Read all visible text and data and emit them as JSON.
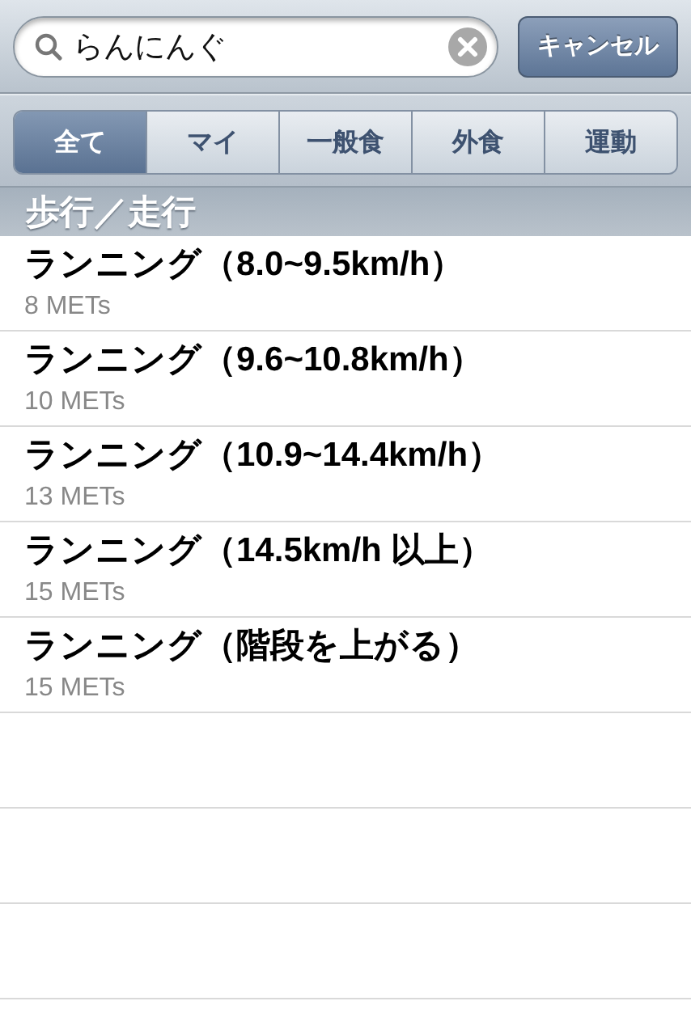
{
  "search": {
    "value": "らんにんぐ",
    "cancel": "キャンセル"
  },
  "tabs": [
    {
      "label": "全て",
      "selected": true
    },
    {
      "label": "マイ",
      "selected": false
    },
    {
      "label": "一般食",
      "selected": false
    },
    {
      "label": "外食",
      "selected": false
    },
    {
      "label": "運動",
      "selected": false
    }
  ],
  "section": {
    "title": "歩行／走行"
  },
  "rows": [
    {
      "title": "ランニング（8.0~9.5km/h）",
      "subtitle": "8 METs"
    },
    {
      "title": "ランニング（9.6~10.8km/h）",
      "subtitle": "10 METs"
    },
    {
      "title": "ランニング（10.9~14.4km/h）",
      "subtitle": "13 METs"
    },
    {
      "title": "ランニング（14.5km/h 以上）",
      "subtitle": "15 METs"
    },
    {
      "title": "ランニング（階段を上がる）",
      "subtitle": "15 METs"
    }
  ]
}
